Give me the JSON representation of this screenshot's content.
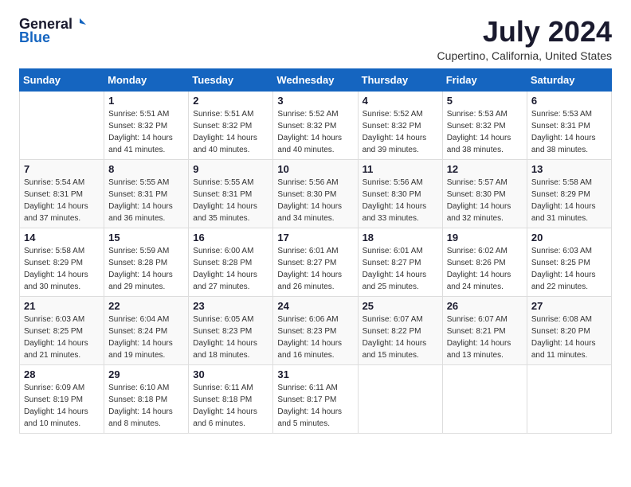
{
  "header": {
    "logo_general": "General",
    "logo_blue": "Blue",
    "month": "July 2024",
    "location": "Cupertino, California, United States"
  },
  "weekdays": [
    "Sunday",
    "Monday",
    "Tuesday",
    "Wednesday",
    "Thursday",
    "Friday",
    "Saturday"
  ],
  "weeks": [
    [
      {
        "day": "",
        "sunrise": "",
        "sunset": "",
        "daylight": ""
      },
      {
        "day": "1",
        "sunrise": "Sunrise: 5:51 AM",
        "sunset": "Sunset: 8:32 PM",
        "daylight": "Daylight: 14 hours and 41 minutes."
      },
      {
        "day": "2",
        "sunrise": "Sunrise: 5:51 AM",
        "sunset": "Sunset: 8:32 PM",
        "daylight": "Daylight: 14 hours and 40 minutes."
      },
      {
        "day": "3",
        "sunrise": "Sunrise: 5:52 AM",
        "sunset": "Sunset: 8:32 PM",
        "daylight": "Daylight: 14 hours and 40 minutes."
      },
      {
        "day": "4",
        "sunrise": "Sunrise: 5:52 AM",
        "sunset": "Sunset: 8:32 PM",
        "daylight": "Daylight: 14 hours and 39 minutes."
      },
      {
        "day": "5",
        "sunrise": "Sunrise: 5:53 AM",
        "sunset": "Sunset: 8:32 PM",
        "daylight": "Daylight: 14 hours and 38 minutes."
      },
      {
        "day": "6",
        "sunrise": "Sunrise: 5:53 AM",
        "sunset": "Sunset: 8:31 PM",
        "daylight": "Daylight: 14 hours and 38 minutes."
      }
    ],
    [
      {
        "day": "7",
        "sunrise": "Sunrise: 5:54 AM",
        "sunset": "Sunset: 8:31 PM",
        "daylight": "Daylight: 14 hours and 37 minutes."
      },
      {
        "day": "8",
        "sunrise": "Sunrise: 5:55 AM",
        "sunset": "Sunset: 8:31 PM",
        "daylight": "Daylight: 14 hours and 36 minutes."
      },
      {
        "day": "9",
        "sunrise": "Sunrise: 5:55 AM",
        "sunset": "Sunset: 8:31 PM",
        "daylight": "Daylight: 14 hours and 35 minutes."
      },
      {
        "day": "10",
        "sunrise": "Sunrise: 5:56 AM",
        "sunset": "Sunset: 8:30 PM",
        "daylight": "Daylight: 14 hours and 34 minutes."
      },
      {
        "day": "11",
        "sunrise": "Sunrise: 5:56 AM",
        "sunset": "Sunset: 8:30 PM",
        "daylight": "Daylight: 14 hours and 33 minutes."
      },
      {
        "day": "12",
        "sunrise": "Sunrise: 5:57 AM",
        "sunset": "Sunset: 8:30 PM",
        "daylight": "Daylight: 14 hours and 32 minutes."
      },
      {
        "day": "13",
        "sunrise": "Sunrise: 5:58 AM",
        "sunset": "Sunset: 8:29 PM",
        "daylight": "Daylight: 14 hours and 31 minutes."
      }
    ],
    [
      {
        "day": "14",
        "sunrise": "Sunrise: 5:58 AM",
        "sunset": "Sunset: 8:29 PM",
        "daylight": "Daylight: 14 hours and 30 minutes."
      },
      {
        "day": "15",
        "sunrise": "Sunrise: 5:59 AM",
        "sunset": "Sunset: 8:28 PM",
        "daylight": "Daylight: 14 hours and 29 minutes."
      },
      {
        "day": "16",
        "sunrise": "Sunrise: 6:00 AM",
        "sunset": "Sunset: 8:28 PM",
        "daylight": "Daylight: 14 hours and 27 minutes."
      },
      {
        "day": "17",
        "sunrise": "Sunrise: 6:01 AM",
        "sunset": "Sunset: 8:27 PM",
        "daylight": "Daylight: 14 hours and 26 minutes."
      },
      {
        "day": "18",
        "sunrise": "Sunrise: 6:01 AM",
        "sunset": "Sunset: 8:27 PM",
        "daylight": "Daylight: 14 hours and 25 minutes."
      },
      {
        "day": "19",
        "sunrise": "Sunrise: 6:02 AM",
        "sunset": "Sunset: 8:26 PM",
        "daylight": "Daylight: 14 hours and 24 minutes."
      },
      {
        "day": "20",
        "sunrise": "Sunrise: 6:03 AM",
        "sunset": "Sunset: 8:25 PM",
        "daylight": "Daylight: 14 hours and 22 minutes."
      }
    ],
    [
      {
        "day": "21",
        "sunrise": "Sunrise: 6:03 AM",
        "sunset": "Sunset: 8:25 PM",
        "daylight": "Daylight: 14 hours and 21 minutes."
      },
      {
        "day": "22",
        "sunrise": "Sunrise: 6:04 AM",
        "sunset": "Sunset: 8:24 PM",
        "daylight": "Daylight: 14 hours and 19 minutes."
      },
      {
        "day": "23",
        "sunrise": "Sunrise: 6:05 AM",
        "sunset": "Sunset: 8:23 PM",
        "daylight": "Daylight: 14 hours and 18 minutes."
      },
      {
        "day": "24",
        "sunrise": "Sunrise: 6:06 AM",
        "sunset": "Sunset: 8:23 PM",
        "daylight": "Daylight: 14 hours and 16 minutes."
      },
      {
        "day": "25",
        "sunrise": "Sunrise: 6:07 AM",
        "sunset": "Sunset: 8:22 PM",
        "daylight": "Daylight: 14 hours and 15 minutes."
      },
      {
        "day": "26",
        "sunrise": "Sunrise: 6:07 AM",
        "sunset": "Sunset: 8:21 PM",
        "daylight": "Daylight: 14 hours and 13 minutes."
      },
      {
        "day": "27",
        "sunrise": "Sunrise: 6:08 AM",
        "sunset": "Sunset: 8:20 PM",
        "daylight": "Daylight: 14 hours and 11 minutes."
      }
    ],
    [
      {
        "day": "28",
        "sunrise": "Sunrise: 6:09 AM",
        "sunset": "Sunset: 8:19 PM",
        "daylight": "Daylight: 14 hours and 10 minutes."
      },
      {
        "day": "29",
        "sunrise": "Sunrise: 6:10 AM",
        "sunset": "Sunset: 8:18 PM",
        "daylight": "Daylight: 14 hours and 8 minutes."
      },
      {
        "day": "30",
        "sunrise": "Sunrise: 6:11 AM",
        "sunset": "Sunset: 8:18 PM",
        "daylight": "Daylight: 14 hours and 6 minutes."
      },
      {
        "day": "31",
        "sunrise": "Sunrise: 6:11 AM",
        "sunset": "Sunset: 8:17 PM",
        "daylight": "Daylight: 14 hours and 5 minutes."
      },
      {
        "day": "",
        "sunrise": "",
        "sunset": "",
        "daylight": ""
      },
      {
        "day": "",
        "sunrise": "",
        "sunset": "",
        "daylight": ""
      },
      {
        "day": "",
        "sunrise": "",
        "sunset": "",
        "daylight": ""
      }
    ]
  ]
}
